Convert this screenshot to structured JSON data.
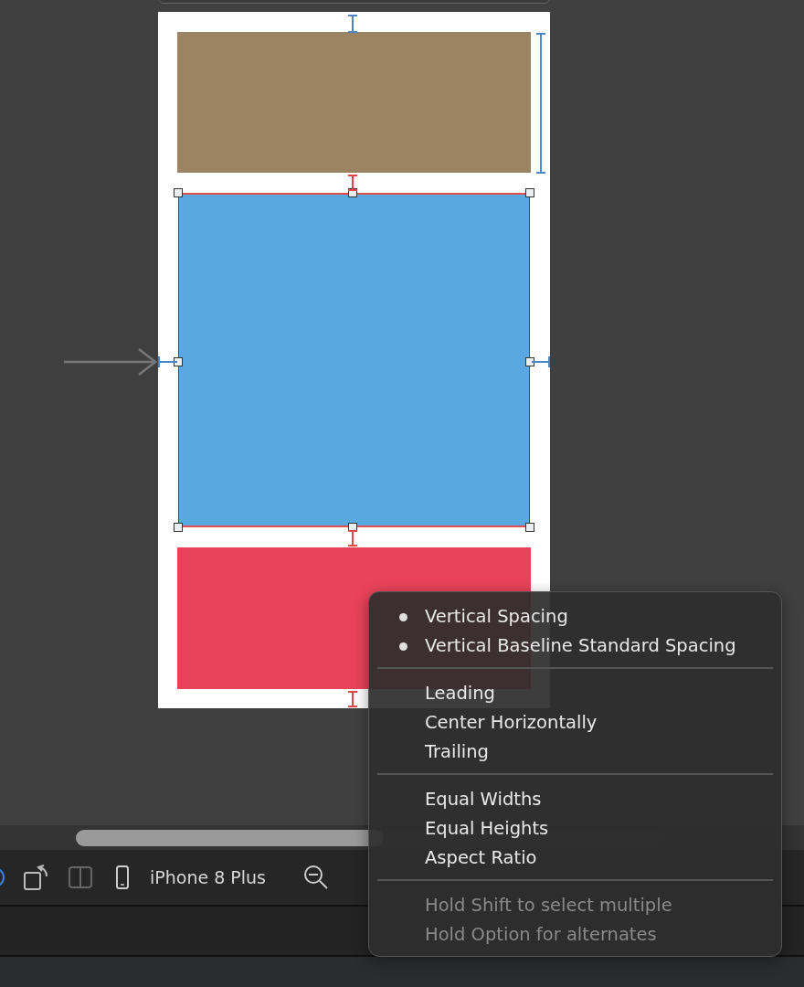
{
  "toolbar": {
    "device": "iPhone 8 Plus"
  },
  "menu": {
    "sections": [
      {
        "items": [
          {
            "label": "Vertical Spacing",
            "marked": true,
            "disabled": false
          },
          {
            "label": "Vertical Baseline Standard Spacing",
            "marked": true,
            "disabled": false
          }
        ]
      },
      {
        "items": [
          {
            "label": "Leading",
            "marked": false,
            "disabled": false
          },
          {
            "label": "Center Horizontally",
            "marked": false,
            "disabled": false
          },
          {
            "label": "Trailing",
            "marked": false,
            "disabled": false
          }
        ]
      },
      {
        "items": [
          {
            "label": "Equal Widths",
            "marked": false,
            "disabled": false
          },
          {
            "label": "Equal Heights",
            "marked": false,
            "disabled": false
          },
          {
            "label": "Aspect Ratio",
            "marked": false,
            "disabled": false
          }
        ]
      },
      {
        "items": [
          {
            "label": "Hold Shift to select multiple",
            "marked": false,
            "disabled": true
          },
          {
            "label": "Hold Option for alternates",
            "marked": false,
            "disabled": true
          }
        ]
      }
    ]
  }
}
